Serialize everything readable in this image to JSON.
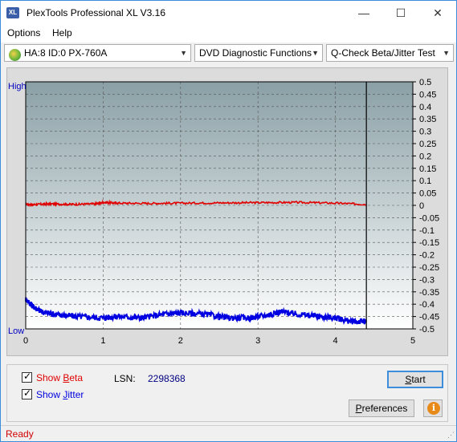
{
  "window": {
    "title": "PlexTools Professional XL V3.16",
    "icon_label": "XL",
    "controls": {
      "minimize": "—",
      "maximize": "☐",
      "close": "✕"
    }
  },
  "menu": {
    "options": "Options",
    "help": "Help"
  },
  "toolbar": {
    "drive": "HA:8 ID:0  PX-760A",
    "function": "DVD Diagnostic Functions",
    "test": "Q-Check Beta/Jitter Test"
  },
  "chart_data": {
    "type": "line",
    "left_axis_labels": {
      "high": "High",
      "low": "Low"
    },
    "x_ticks": [
      "0",
      "1",
      "2",
      "3",
      "4",
      "5"
    ],
    "xlim": [
      0,
      5
    ],
    "y_right_ticks": [
      "0.5",
      "0.45",
      "0.4",
      "0.35",
      "0.3",
      "0.25",
      "0.2",
      "0.15",
      "0.1",
      "0.05",
      "0",
      "-0.05",
      "-0.1",
      "-0.15",
      "-0.2",
      "-0.25",
      "-0.3",
      "-0.35",
      "-0.4",
      "-0.45",
      "-0.5"
    ],
    "ylim": [
      -0.5,
      0.5
    ],
    "end_marker_x": 4.4,
    "grid": true,
    "series": [
      {
        "color": "#e00000",
        "x": [
          0,
          0.1,
          0.3,
          0.6,
          0.9,
          1.0,
          1.2,
          1.6,
          2.0,
          2.5,
          3.0,
          3.5,
          4.0,
          4.4
        ],
        "y": [
          0.005,
          0.003,
          0.006,
          0.004,
          0.006,
          0.012,
          0.009,
          0.008,
          0.009,
          0.01,
          0.011,
          0.012,
          0.009,
          0.004
        ]
      },
      {
        "color": "#0000e0",
        "x": [
          0,
          0.1,
          0.2,
          0.35,
          0.5,
          0.7,
          1.0,
          1.2,
          1.5,
          1.8,
          2.0,
          2.3,
          2.6,
          2.9,
          3.1,
          3.3,
          3.5,
          3.8,
          4.0,
          4.2,
          4.4
        ],
        "y": [
          -0.38,
          -0.41,
          -0.43,
          -0.44,
          -0.445,
          -0.45,
          -0.455,
          -0.45,
          -0.455,
          -0.44,
          -0.435,
          -0.44,
          -0.455,
          -0.455,
          -0.445,
          -0.43,
          -0.44,
          -0.45,
          -0.455,
          -0.47,
          -0.47
        ]
      }
    ]
  },
  "options": {
    "show_beta_prefix": "Show ",
    "show_beta_accel": "B",
    "show_beta_suffix": "eta",
    "show_jitter_prefix": "Show ",
    "show_jitter_accel": "J",
    "show_jitter_suffix": "itter",
    "lsn_label": "LSN:",
    "lsn_value": "2298368",
    "start_accel": "S",
    "start_suffix": "tart",
    "preferences_accel": "P",
    "preferences_suffix": "references"
  },
  "colors": {
    "beta": "#e00000",
    "jitter": "#0000e0",
    "accent": "#3c8edc"
  },
  "status": {
    "text": "Ready"
  }
}
